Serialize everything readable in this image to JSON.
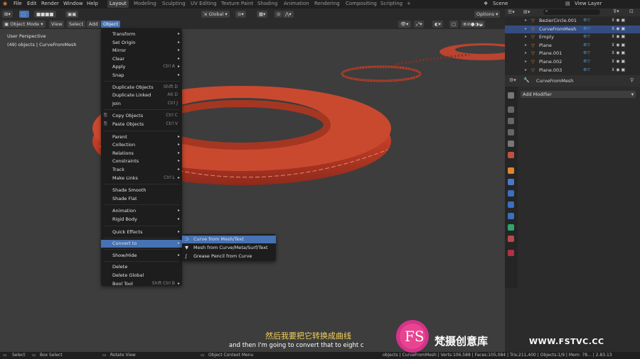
{
  "topbar": {
    "menus": [
      "File",
      "Edit",
      "Render",
      "Window",
      "Help"
    ],
    "workspaces": [
      "Layout",
      "Modeling",
      "Sculpting",
      "UV Editing",
      "Texture Paint",
      "Shading",
      "Animation",
      "Rendering",
      "Compositing",
      "Scripting"
    ],
    "active_workspace": "Layout",
    "add_tab": "+",
    "scene": "Scene",
    "view_layer": "View Layer"
  },
  "header": {
    "mode": "Object Mode",
    "menus": [
      "View",
      "Select",
      "Add",
      "Object"
    ],
    "active_menu": "Object",
    "orientation": "Global",
    "options": "Options"
  },
  "viewport": {
    "perspective": "User Perspective",
    "info": "(49) objects | CurveFromMesh"
  },
  "object_menu": [
    {
      "label": "Transform",
      "shortcut": "",
      "submenu": true
    },
    {
      "label": "Set Origin",
      "shortcut": "",
      "submenu": true
    },
    {
      "label": "Mirror",
      "shortcut": "",
      "submenu": true
    },
    {
      "label": "Clear",
      "shortcut": "",
      "submenu": true
    },
    {
      "label": "Apply",
      "shortcut": "Ctrl A",
      "submenu": true
    },
    {
      "label": "Snap",
      "shortcut": "",
      "submenu": true
    },
    {
      "label": "Duplicate Objects",
      "shortcut": "Shift D",
      "submenu": false
    },
    {
      "label": "Duplicate Linked",
      "shortcut": "Alt D",
      "submenu": false
    },
    {
      "label": "Join",
      "shortcut": "Ctrl J",
      "submenu": false
    },
    {
      "label": "Copy Objects",
      "shortcut": "Ctrl C",
      "submenu": false
    },
    {
      "label": "Paste Objects",
      "shortcut": "Ctrl V",
      "submenu": false
    },
    {
      "label": "Parent",
      "shortcut": "",
      "submenu": true
    },
    {
      "label": "Collection",
      "shortcut": "",
      "submenu": true
    },
    {
      "label": "Relations",
      "shortcut": "",
      "submenu": true
    },
    {
      "label": "Constraints",
      "shortcut": "",
      "submenu": true
    },
    {
      "label": "Track",
      "shortcut": "",
      "submenu": true
    },
    {
      "label": "Make Links",
      "shortcut": "Ctrl L",
      "submenu": true
    },
    {
      "label": "Shade Smooth",
      "shortcut": "",
      "submenu": false
    },
    {
      "label": "Shade Flat",
      "shortcut": "",
      "submenu": false
    },
    {
      "label": "Animation",
      "shortcut": "",
      "submenu": true
    },
    {
      "label": "Rigid Body",
      "shortcut": "",
      "submenu": true
    },
    {
      "label": "Quick Effects",
      "shortcut": "",
      "submenu": true
    },
    {
      "label": "Convert to",
      "shortcut": "",
      "submenu": true
    },
    {
      "label": "Show/Hide",
      "shortcut": "",
      "submenu": true
    },
    {
      "label": "Delete",
      "shortcut": "",
      "submenu": false
    },
    {
      "label": "Delete Global",
      "shortcut": "",
      "submenu": false
    },
    {
      "label": "Bool Tool",
      "shortcut": "Shift Ctrl B",
      "submenu": true
    }
  ],
  "convert_submenu": [
    {
      "label": "Curve from Mesh/Text",
      "icon": "curve-icon"
    },
    {
      "label": "Mesh from Curve/Meta/Surf/Text",
      "icon": "mesh-icon"
    },
    {
      "label": "Grease Pencil from Curve",
      "icon": "grease-pencil-icon"
    }
  ],
  "outliner": {
    "search_placeholder": "",
    "rows": [
      {
        "name": "BezierCircle.001",
        "selected": false
      },
      {
        "name": "CurveFromMesh",
        "selected": true
      },
      {
        "name": "Empty",
        "selected": false
      },
      {
        "name": "Plane",
        "selected": false
      },
      {
        "name": "Plane.001",
        "selected": false
      },
      {
        "name": "Plane.002",
        "selected": false
      },
      {
        "name": "Plane.003",
        "selected": false
      }
    ]
  },
  "properties": {
    "object_name": "CurveFromMesh",
    "add_modifier": "Add Modifier"
  },
  "statusbar": {
    "select": "Select",
    "box_select": "Box Select",
    "rotate_view": "Rotate View",
    "context_menu": "Object Context Menu",
    "stats": "objects | CurveFromMesh | Verts:106,588 | Faces:105,084 | Tris:211,400 | Objects:1/9 | Mem: 78... | 2.83.13"
  },
  "overlay": {
    "subtitle_cn": "然后我要把它转换成曲线",
    "subtitle_en": "and then I'm going to convert that to eight c",
    "brand_cn": "梵摄创意库",
    "brand_url": "WWW.FSTVC.CC",
    "logo_text": "FS"
  },
  "colors": {
    "accent": "#4772b3",
    "ring": "#c8442e",
    "subtitle_cn": "#f5d25a"
  }
}
